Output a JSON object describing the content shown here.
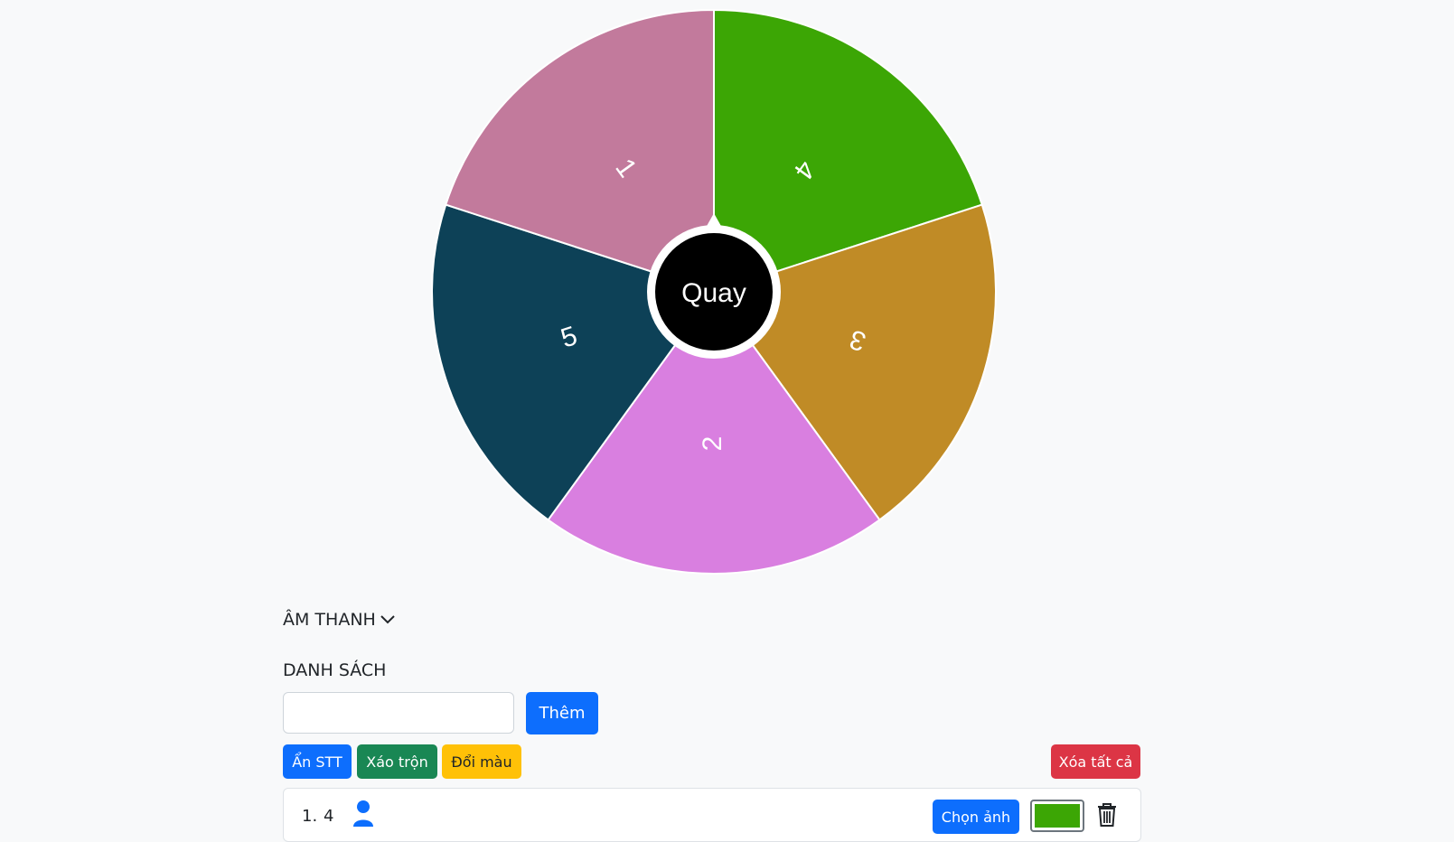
{
  "wheel": {
    "segments": [
      {
        "label": "4",
        "color": "#3ca605"
      },
      {
        "label": "3",
        "color": "#c08b26"
      },
      {
        "label": "2",
        "color": "#d97fe0"
      },
      {
        "label": "5",
        "color": "#0d4157"
      },
      {
        "label": "1",
        "color": "#c27a9c"
      }
    ],
    "spin_label": "Quay",
    "hub_color": "#000000"
  },
  "sound": {
    "label": "ÂM THANH",
    "icon": "chevron-down-icon"
  },
  "list": {
    "title": "DANH SÁCH",
    "input_value": "",
    "add_label": "Thêm",
    "hide_index_label": "Ẩn STT",
    "shuffle_label": "Xáo trộn",
    "change_color_label": "Đổi màu",
    "clear_all_label": "Xóa tất cả",
    "items": [
      {
        "index": "1.",
        "value": "4",
        "choose_image_label": "Chọn ảnh",
        "color": "#3ca605"
      }
    ]
  }
}
